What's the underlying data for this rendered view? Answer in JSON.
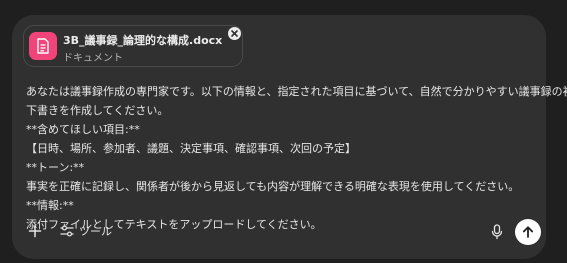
{
  "attachment": {
    "file_name": "3B_議事録_論理的な構成.docx",
    "file_type": "ドキュメント",
    "icon": "document-icon",
    "icon_color": "#f0447a"
  },
  "message": {
    "lines": [
      "あなたは議事録作成の専門家です。以下の情報と、指定された項目に基づいて、自然で分かりやすい議事録の初期",
      "下書きを作成してください。",
      "**含めてほしい項目:**",
      "【日時、場所、参加者、議題、決定事項、確認事項、次回の予定】",
      "**トーン:**",
      "事実を正確に記録し、関係者が後から見返しても内容が理解できる明確な表現を使用してください。",
      "**情報:**",
      "添付ファイルとしてテキストをアップロードしてください。"
    ]
  },
  "toolbar": {
    "add_icon": "plus-icon",
    "tools_icon": "sliders-icon",
    "tools_label": "ツール",
    "mic_icon": "microphone-icon",
    "send_icon": "arrow-up-icon"
  },
  "colors": {
    "background": "#1f1f1f",
    "panel": "#303030",
    "text": "#e6e6e6",
    "send_button": "#ffffff"
  }
}
